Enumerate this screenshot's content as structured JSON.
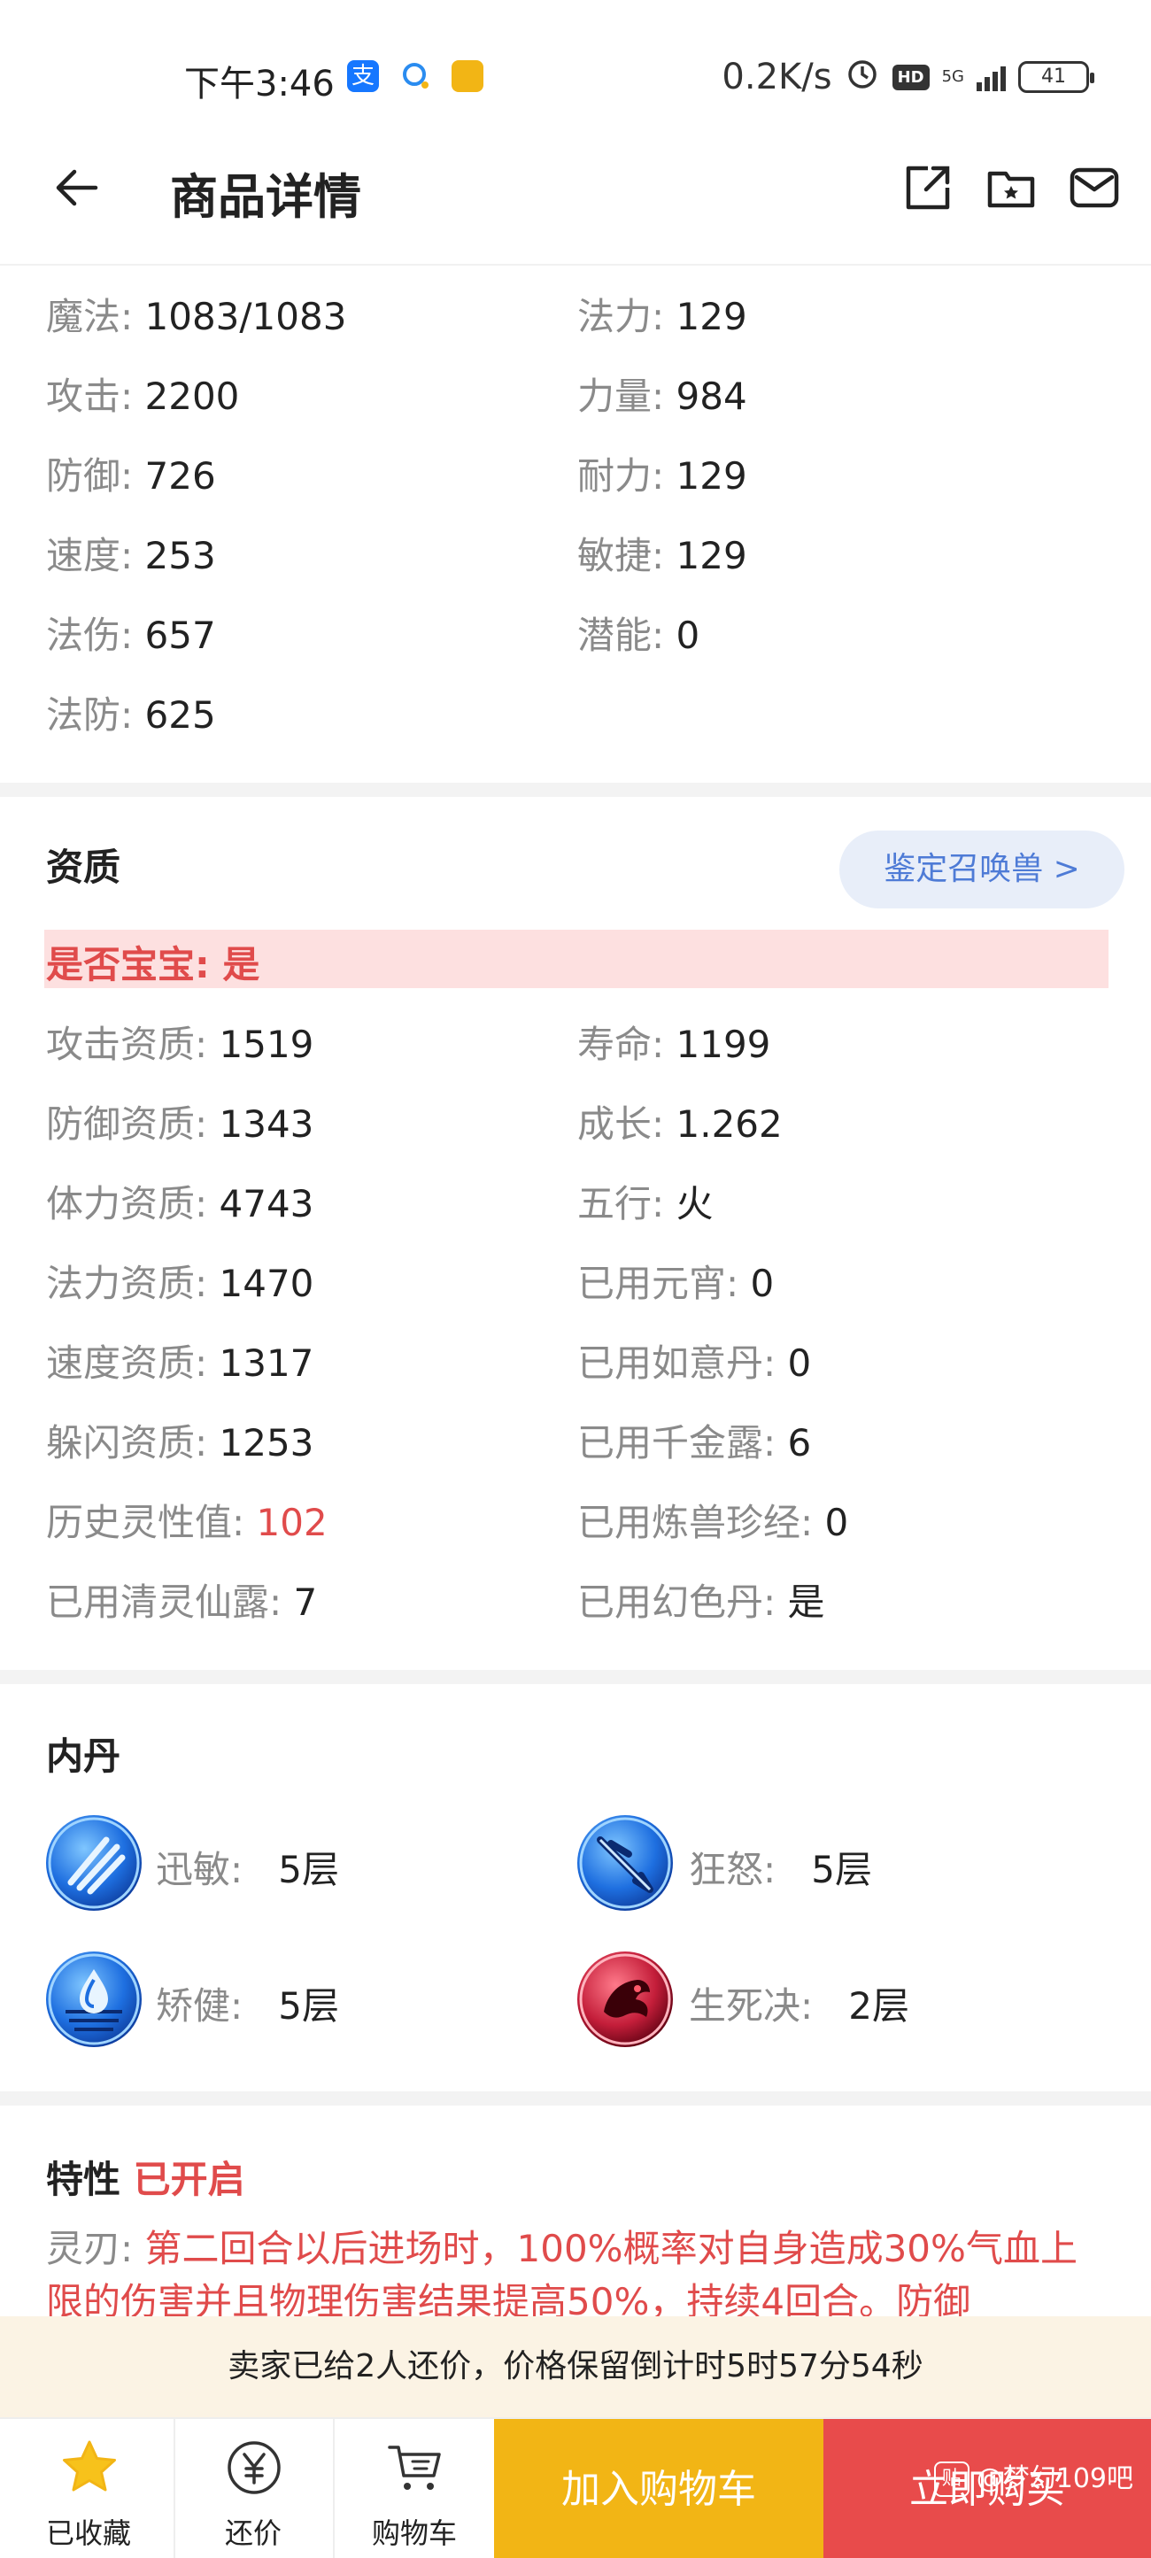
{
  "status_bar": {
    "time": "下午3:46",
    "net_speed": "0.2K/s",
    "hd": "HD",
    "network": "5G",
    "battery": "41"
  },
  "navbar": {
    "title": "商品详情"
  },
  "stats": {
    "left": [
      {
        "label": "魔法:",
        "value": "1083/1083"
      },
      {
        "label": "攻击:",
        "value": "2200"
      },
      {
        "label": "防御:",
        "value": "726"
      },
      {
        "label": "速度:",
        "value": "253"
      },
      {
        "label": "法伤:",
        "value": "657"
      },
      {
        "label": "法防:",
        "value": "625"
      }
    ],
    "right": [
      {
        "label": "法力:",
        "value": "129"
      },
      {
        "label": "力量:",
        "value": "984"
      },
      {
        "label": "耐力:",
        "value": "129"
      },
      {
        "label": "敏捷:",
        "value": "129"
      },
      {
        "label": "潜能:",
        "value": "0"
      }
    ]
  },
  "aptitude": {
    "title": "资质",
    "appraise_button": "鉴定召唤兽 >",
    "is_baby": "是否宝宝: 是",
    "left": [
      {
        "label": "攻击资质:",
        "value": "1519"
      },
      {
        "label": "防御资质:",
        "value": "1343"
      },
      {
        "label": "体力资质:",
        "value": "4743"
      },
      {
        "label": "法力资质:",
        "value": "1470"
      },
      {
        "label": "速度资质:",
        "value": "1317"
      },
      {
        "label": "躲闪资质:",
        "value": "1253"
      },
      {
        "label": "历史灵性值:",
        "value": "102"
      },
      {
        "label": "已用清灵仙露:",
        "value": "7"
      }
    ],
    "right": [
      {
        "label": "寿命:",
        "value": "1199"
      },
      {
        "label": "成长:",
        "value": "1.262"
      },
      {
        "label": "五行:",
        "value": "火"
      },
      {
        "label": "已用元宵:",
        "value": "0"
      },
      {
        "label": "已用如意丹:",
        "value": "0"
      },
      {
        "label": "已用千金露:",
        "value": "6"
      },
      {
        "label": "已用炼兽珍经:",
        "value": "0"
      },
      {
        "label": "已用幻色丹:",
        "value": "是"
      }
    ]
  },
  "inner_dan": {
    "title": "内丹",
    "items": [
      {
        "name": "迅敏:",
        "level": "5层",
        "icon": "swift-dan-icon",
        "color": "#2a6fd6"
      },
      {
        "name": "狂怒:",
        "level": "5层",
        "icon": "fury-dan-icon",
        "color": "#2a6fd6"
      },
      {
        "name": "矫健:",
        "level": "5层",
        "icon": "vigor-dan-icon",
        "color": "#2a6fd6"
      },
      {
        "name": "生死决:",
        "level": "2层",
        "icon": "life-death-dan-icon",
        "color": "#c41e3a"
      }
    ]
  },
  "trait": {
    "title": "特性",
    "status": "已开启",
    "label": "灵刃:",
    "text": "第二回合以后进场时，100%概率对自身造成30%气血上限的伤害并且物理伤害结果提高50%，持续4回合。防御"
  },
  "notice": "卖家已给2人还价，价格保留倒计时5时57分54秒",
  "bottom_bar": {
    "favorite": "已收藏",
    "bargain": "还价",
    "cart": "购物车",
    "add_to_cart": "加入购物车",
    "buy_now": "立即购买",
    "watermark": "@梦幻109吧",
    "watermark_icon": "贴"
  },
  "colors": {
    "accent_red": "#e04b4b",
    "cart_yellow": "#f2b515",
    "buy_red": "#e84b4b",
    "appraise_blue": "#4e7bd6"
  }
}
